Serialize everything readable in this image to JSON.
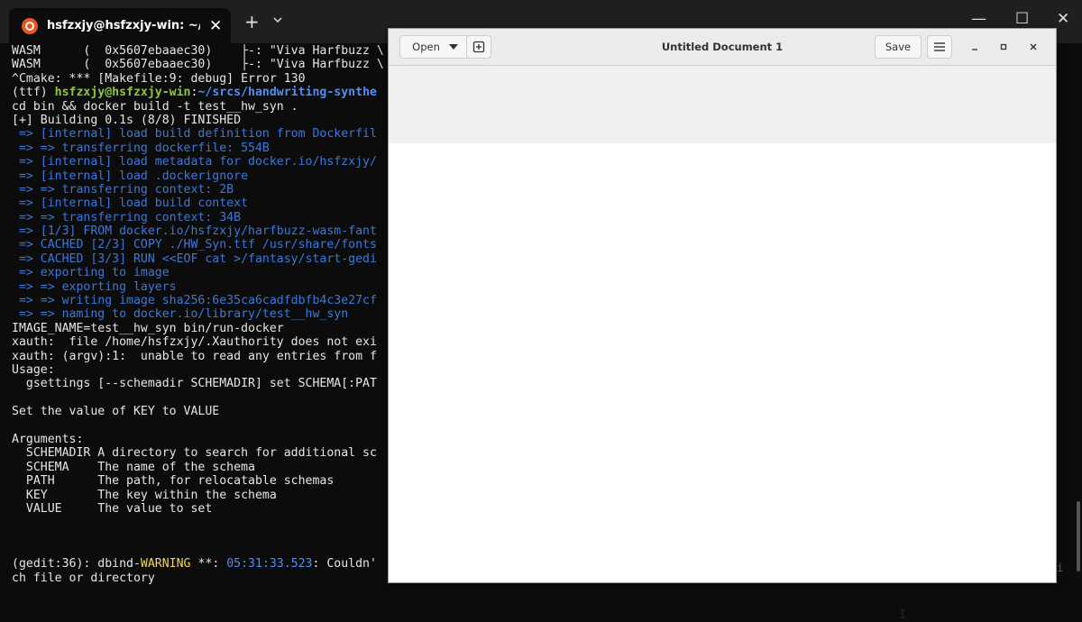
{
  "terminal": {
    "tab_title": "hsfzxjy@hsfzxjy-win: ~/srcs/h",
    "tab_close": "✕",
    "new_tab": "+",
    "controls": {
      "minimize": "—",
      "maximize": "☐",
      "close": "✕"
    },
    "lines": [
      "WASM      (  0x5607ebaaec30)    ├-: \"Viva Harfbuzz \\",
      "WASM      (  0x5607ebaaec30)    ├-: \"Viva Harfbuzz \\",
      "^Cmake: *** [Makefile:9: debug] Error 130",
      "cd bin && docker build -t test__hw_syn .",
      "[+] Building 0.1s (8/8) FINISHED",
      " => [internal] load build definition from Dockerfil",
      " => => transferring dockerfile: 554B",
      " => [internal] load metadata for docker.io/hsfzxjy/",
      " => [internal] load .dockerignore",
      " => => transferring context: 2B",
      " => [internal] load build context",
      " => => transferring context: 34B",
      " => [1/3] FROM docker.io/hsfzxjy/harfbuzz-wasm-fant",
      " => CACHED [2/3] COPY ./HW_Syn.ttf /usr/share/fonts",
      " => CACHED [3/3] RUN <<EOF cat >/fantasy/start-gedi",
      " => exporting to image",
      " => => exporting layers",
      " => => writing image sha256:6e35ca6cadfdbfb4c3e27cf",
      " => => naming to docker.io/library/test__hw_syn",
      "IMAGE_NAME=test__hw_syn bin/run-docker",
      "xauth:  file /home/hsfzxjy/.Xauthority does not exi",
      "xauth: (argv):1:  unable to read any entries from f",
      "Usage:",
      "  gsettings [--schemadir SCHEMADIR] set SCHEMA[:PAT",
      "",
      "Set the value of KEY to VALUE",
      "",
      "Arguments:",
      "  SCHEMADIR A directory to search for additional sc",
      "  SCHEMA    The name of the schema",
      "  PATH      The path, for relocatable schemas",
      "  KEY       The key within the schema",
      "  VALUE     The value to set",
      "",
      "",
      "",
      "",
      "ch file or directory"
    ],
    "prompt_line": {
      "prefix": "(ttf) ",
      "user_host": "hsfzxjy@hsfzxjy-win",
      "colon": ":",
      "path": "~/srcs/handwriting-synthe"
    },
    "warning_line": {
      "prefix": "(gedit:36): dbind-",
      "level": "WARNING",
      "middle": " **: ",
      "timestamp": "05:31:33.523",
      "message": ": Couldn'"
    },
    "edge_fragment": "i"
  },
  "gedit": {
    "open_label": "Open",
    "save_label": "Save",
    "title": "Untitled Document 1"
  }
}
